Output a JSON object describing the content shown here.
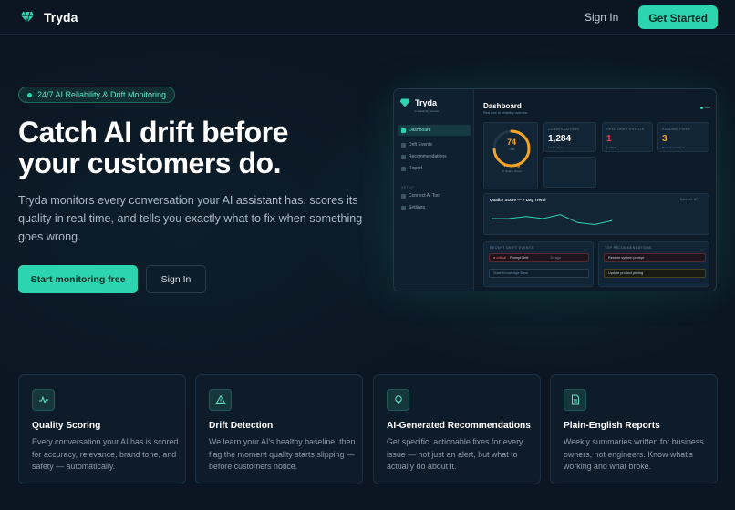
{
  "nav": {
    "brand": "Tryda",
    "sign_in": "Sign In",
    "get_started": "Get Started"
  },
  "hero": {
    "badge": "24/7 AI Reliability & Drift Monitoring",
    "title_line1": "Catch AI drift before",
    "title_line2": "your customers do.",
    "description": "Tryda monitors every conversation your AI assistant has, scores its quality in real time, and tells you exactly what to fix when something goes wrong.",
    "primary_cta": "Start monitoring free",
    "secondary_cta": "Sign In"
  },
  "mock": {
    "brand": "Tryda",
    "brand_sub": "AI Reliability Monitor",
    "nav": [
      "Dashboard",
      "Drift Events",
      "Recommendations",
      "Report"
    ],
    "setup_label": "SETUP",
    "setup_nav": [
      "Connect AI Tool",
      "Settings"
    ],
    "title": "Dashboard",
    "subtitle": "Real-time AI reliability overview",
    "live": "Live",
    "score": 74,
    "score_of": "/ 100",
    "score_status": "Warning",
    "score_label": "AI Quality Score",
    "conversations_label": "CONVERSATIONS",
    "conversations_value": "1,284",
    "conversations_sub": "Last 7 days",
    "drift_label": "OPEN DRIFT EVENTS",
    "drift_value": "1",
    "drift_sub": "1 critical",
    "pending_label": "PENDING FIXES",
    "pending_value": "3",
    "pending_sub": "Recommendations",
    "trend_title": "Quality Score — 7 Day Trend",
    "trend_baseline": "Baseline: 87",
    "trend_values": [
      76,
      76,
      77,
      76,
      78,
      74,
      73,
      75
    ],
    "recent_label": "RECENT DRIFT EVENTS",
    "recent_events": [
      {
        "tag": "● critical",
        "name": "Prompt Drift",
        "time": "2d ago"
      },
      {
        "tag": "",
        "name": "Stale Knowledge Base",
        "time": ""
      }
    ],
    "recs_label": "TOP RECOMMENDATIONS",
    "recs": [
      "Restore system prompt",
      "Update product pricing"
    ]
  },
  "features": [
    {
      "icon": "activity-icon",
      "title": "Quality Scoring",
      "desc": "Every conversation your AI has is scored for accuracy, relevance, brand tone, and safety — automatically."
    },
    {
      "icon": "warning-icon",
      "title": "Drift Detection",
      "desc": "We learn your AI's healthy baseline, then flag the moment quality starts slipping — before customers notice."
    },
    {
      "icon": "lightbulb-icon",
      "title": "AI-Generated Recommendations",
      "desc": "Get specific, actionable fixes for every issue — not just an alert, but what to actually do about it."
    },
    {
      "icon": "document-icon",
      "title": "Plain-English Reports",
      "desc": "Weekly summaries written for business owners, not engineers. Know what's working and what broke."
    }
  ],
  "colors": {
    "accent": "#2dd4b0",
    "background": "#0b1622",
    "warning": "#f5a524",
    "critical": "#ef4444"
  }
}
